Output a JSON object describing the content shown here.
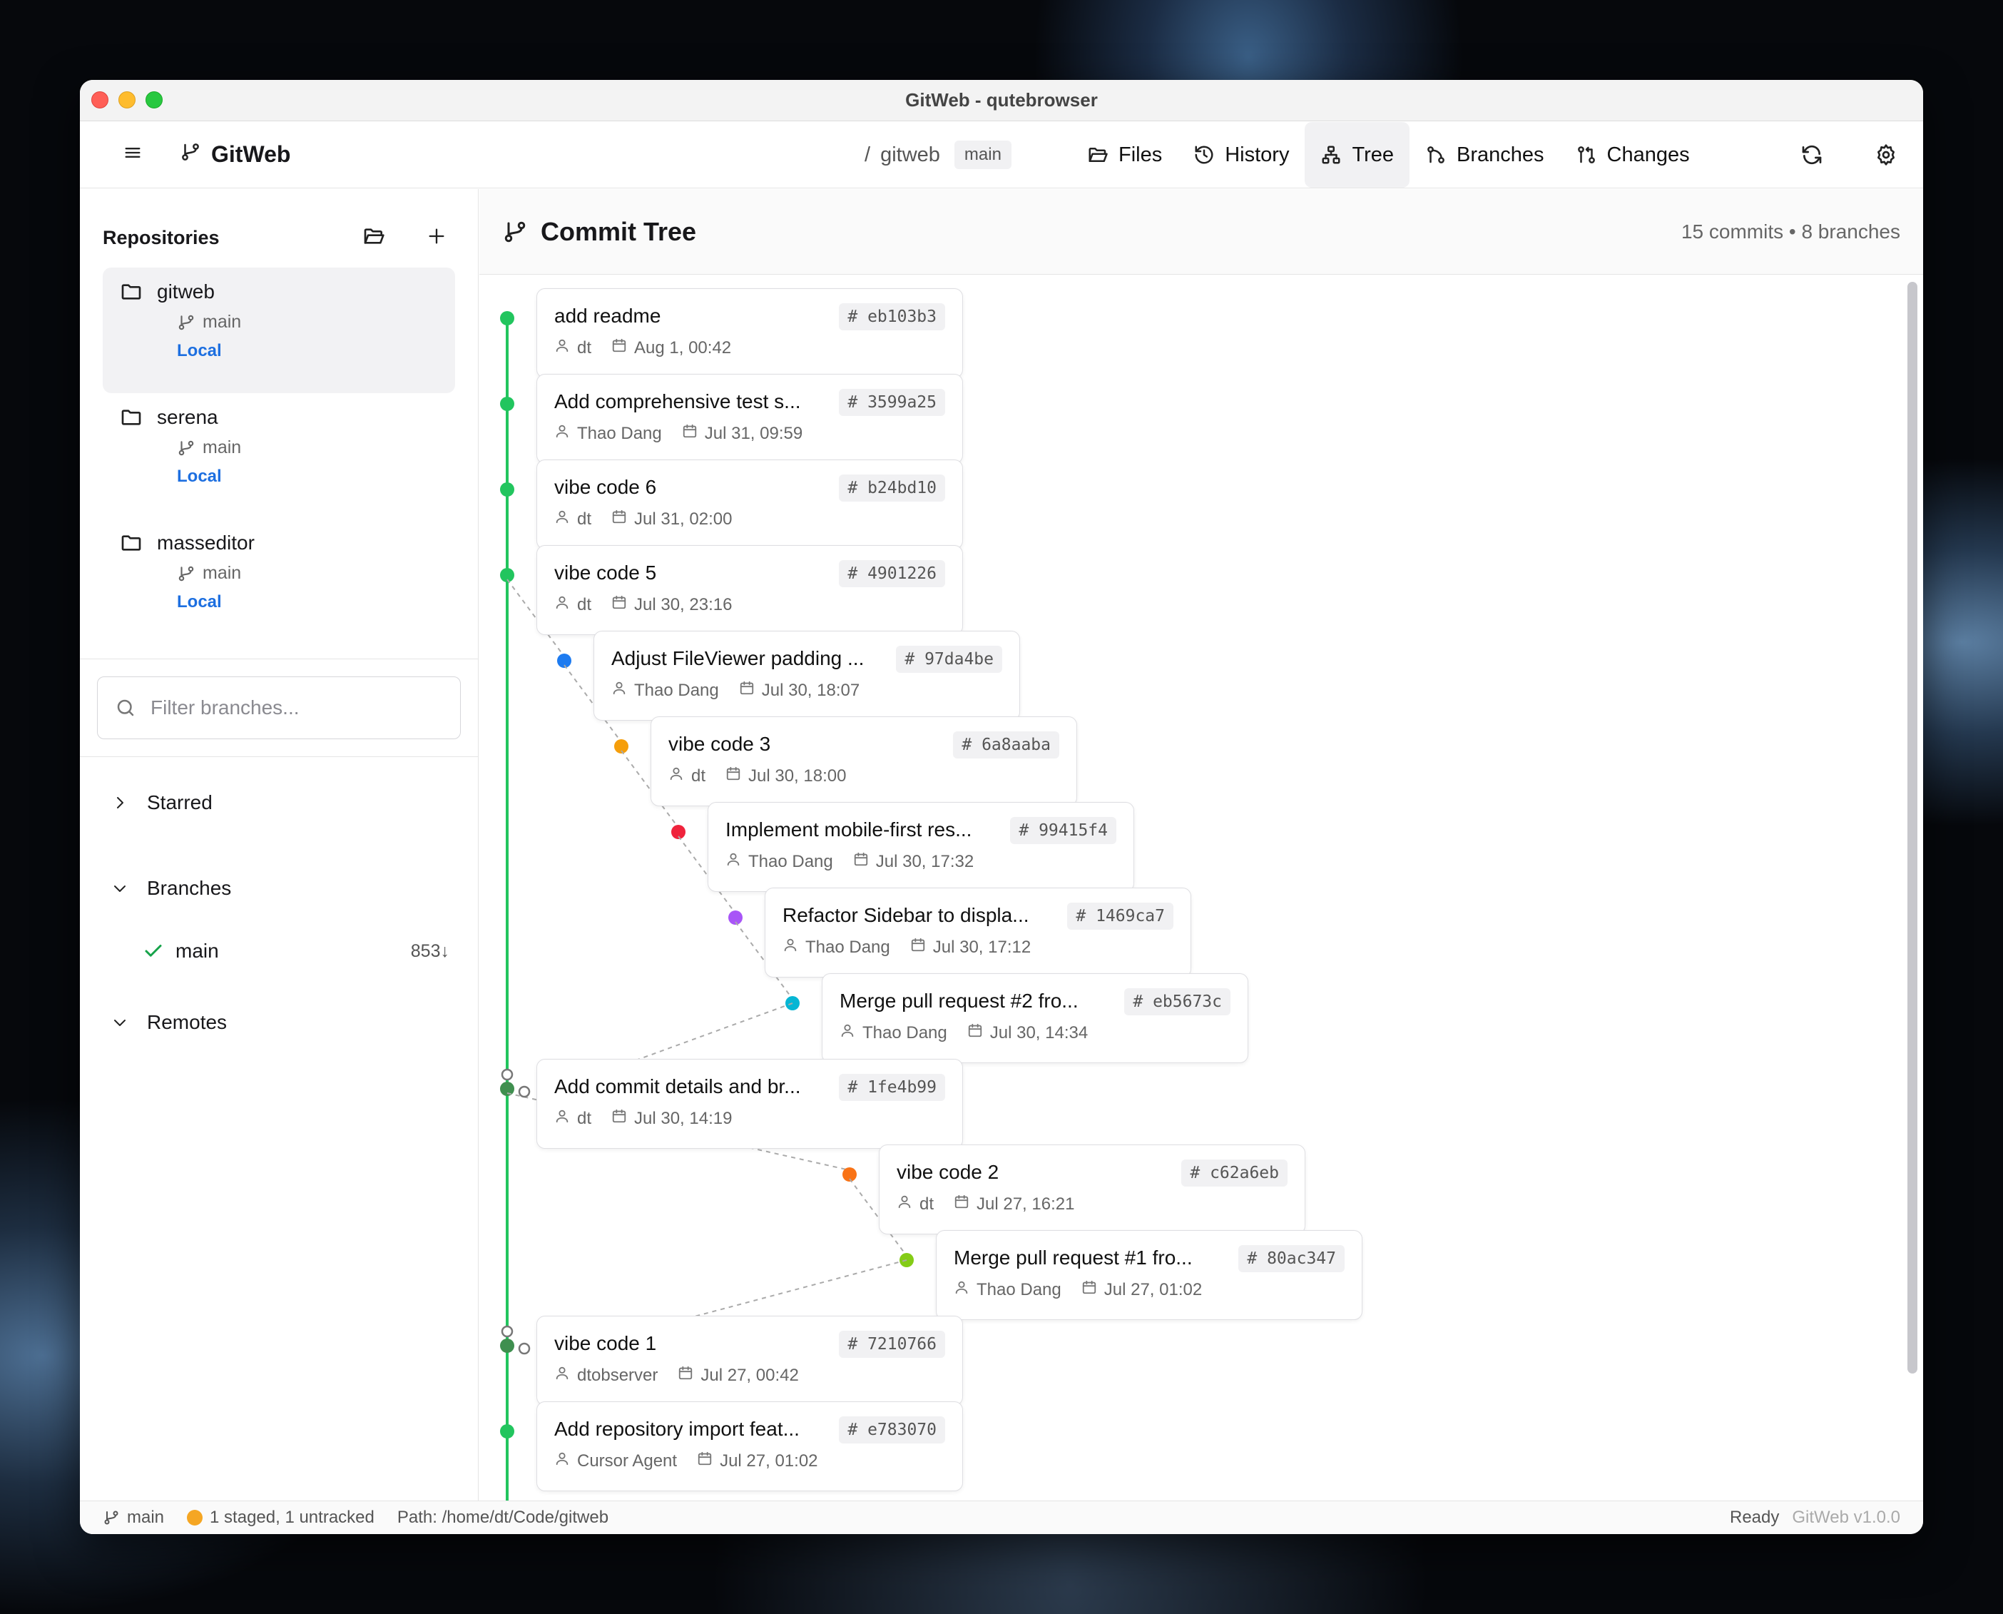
{
  "window": {
    "title": "GitWeb - qutebrowser"
  },
  "topbar": {
    "brand": "GitWeb",
    "crumb_sep": "/",
    "repo": "gitweb",
    "branch": "main",
    "nav": [
      {
        "label": "Files",
        "icon": "folder-open-icon"
      },
      {
        "label": "History",
        "icon": "history-icon"
      },
      {
        "label": "Tree",
        "icon": "tree-icon"
      },
      {
        "label": "Branches",
        "icon": "git-branch-icon"
      },
      {
        "label": "Changes",
        "icon": "git-compare-icon"
      }
    ]
  },
  "sidebar": {
    "repos_title": "Repositories",
    "repos": [
      {
        "name": "gitweb",
        "branch": "main",
        "location": "Local"
      },
      {
        "name": "serena",
        "branch": "main",
        "location": "Local"
      },
      {
        "name": "masseditor",
        "branch": "main",
        "location": "Local"
      }
    ],
    "filter_placeholder": "Filter branches...",
    "starred": "Starred",
    "branches": "Branches",
    "branch_items": [
      {
        "name": "main",
        "count": "853↓"
      }
    ],
    "remotes": "Remotes"
  },
  "main": {
    "title": "Commit Tree",
    "stats": "15 commits • 8 branches",
    "commits": [
      {
        "message": "add readme",
        "hash": "# eb103b3",
        "author": "dt",
        "date": "Aug 1, 00:42",
        "color": "#22c55e"
      },
      {
        "message": "Add comprehensive test s...",
        "hash": "# 3599a25",
        "author": "Thao Dang",
        "date": "Jul 31, 09:59",
        "color": "#22c55e"
      },
      {
        "message": "vibe code 6",
        "hash": "# b24bd10",
        "author": "dt",
        "date": "Jul 31, 02:00",
        "color": "#22c55e"
      },
      {
        "message": "vibe code 5",
        "hash": "# 4901226",
        "author": "dt",
        "date": "Jul 30, 23:16",
        "color": "#22c55e"
      },
      {
        "message": "Adjust FileViewer padding ...",
        "hash": "# 97da4be",
        "author": "Thao Dang",
        "date": "Jul 30, 18:07",
        "color": "#1d7bf0"
      },
      {
        "message": "vibe code 3",
        "hash": "# 6a8aaba",
        "author": "dt",
        "date": "Jul 30, 18:00",
        "color": "#f59e0b"
      },
      {
        "message": "Implement mobile-first res...",
        "hash": "# 99415f4",
        "author": "Thao Dang",
        "date": "Jul 30, 17:32",
        "color": "#ef233c"
      },
      {
        "message": "Refactor Sidebar to displa...",
        "hash": "# 1469ca7",
        "author": "Thao Dang",
        "date": "Jul 30, 17:12",
        "color": "#a855f7"
      },
      {
        "message": "Merge pull request #2 fro...",
        "hash": "# eb5673c",
        "author": "Thao Dang",
        "date": "Jul 30, 14:34",
        "color": "#06b6d4"
      },
      {
        "message": "Add commit details and br...",
        "hash": "# 1fe4b99",
        "author": "dt",
        "date": "Jul 30, 14:19",
        "color": "#3f8f4f"
      },
      {
        "message": "vibe code 2",
        "hash": "# c62a6eb",
        "author": "dt",
        "date": "Jul 27, 16:21",
        "color": "#f97316"
      },
      {
        "message": "Merge pull request #1 fro...",
        "hash": "# 80ac347",
        "author": "Thao Dang",
        "date": "Jul 27, 01:02",
        "color": "#84cc16"
      },
      {
        "message": "vibe code 1",
        "hash": "# 7210766",
        "author": "dtobserver",
        "date": "Jul 27, 00:42",
        "color": "#3f8f4f"
      },
      {
        "message": "Add repository import feat...",
        "hash": "# e783070",
        "author": "Cursor Agent",
        "date": "Jul 27, 01:02",
        "color": "#22c55e"
      }
    ]
  },
  "statusbar": {
    "branch": "main",
    "changes": "1 staged, 1 untracked",
    "path": "Path: /home/dt/Code/gitweb",
    "status": "Ready",
    "version": "GitWeb v1.0.0"
  }
}
